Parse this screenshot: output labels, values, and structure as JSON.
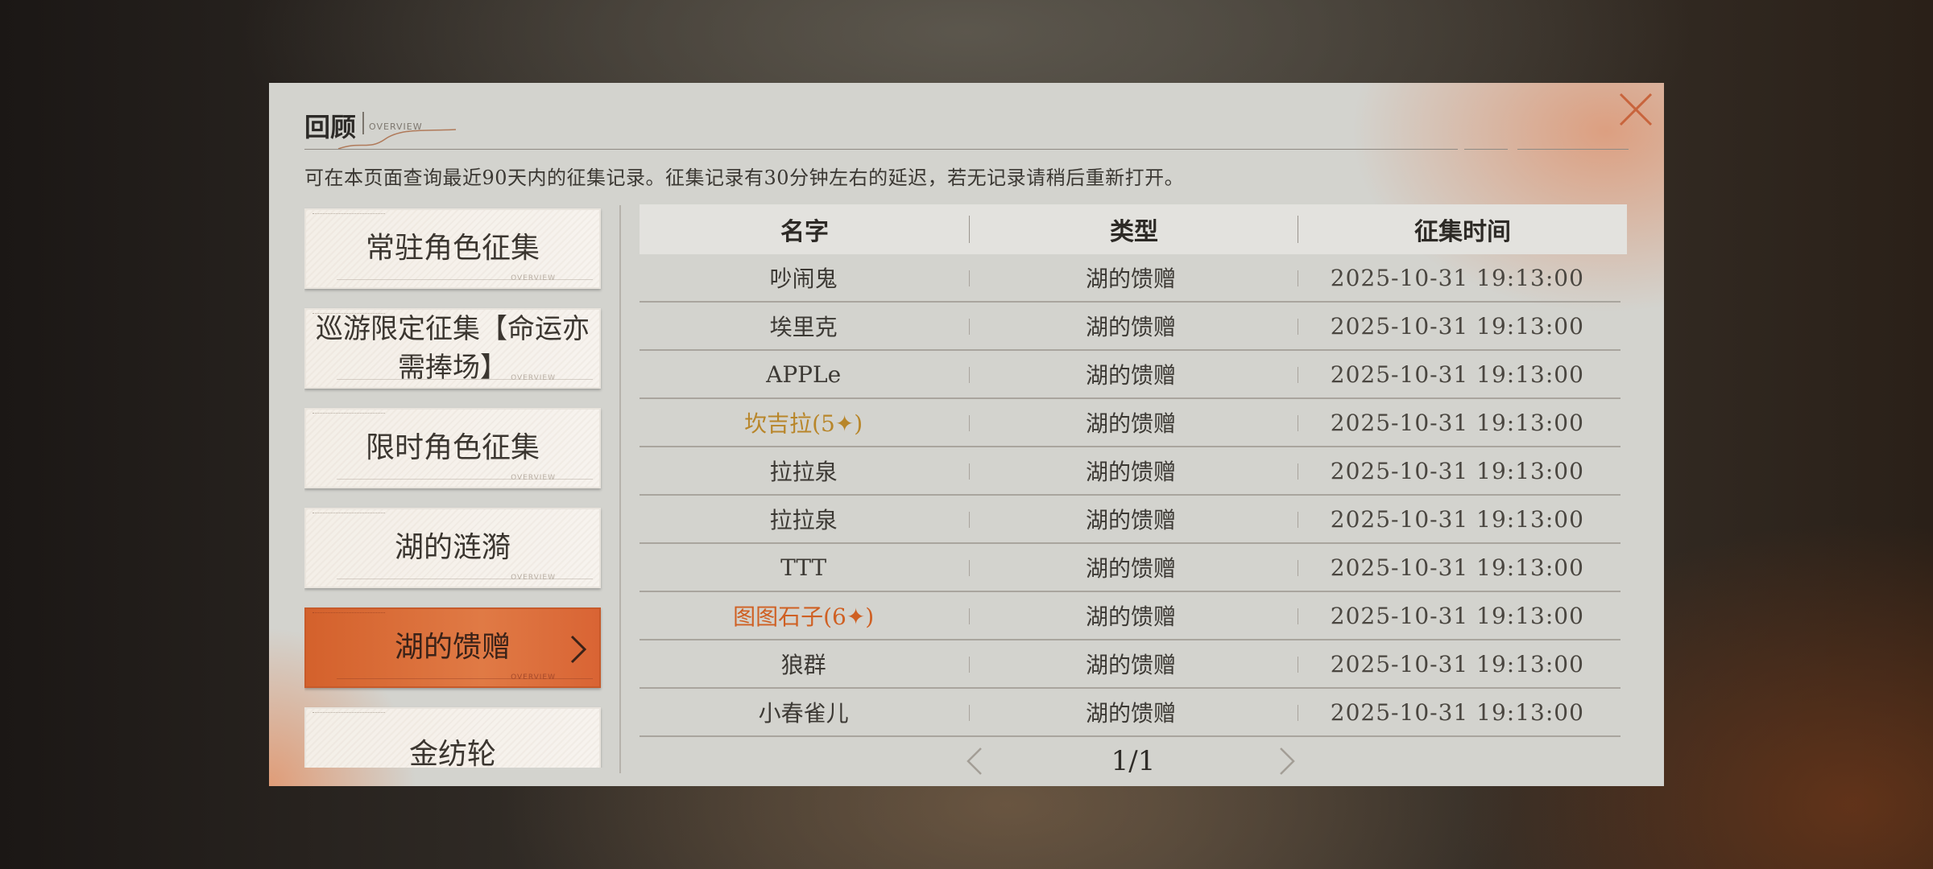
{
  "window": {
    "title": "回顾",
    "subtitle": "OVERVIEW",
    "notice": "可在本页面查询最近90天内的征集记录。征集记录有30分钟左右的延迟，若无记录请稍后重新打开。"
  },
  "sidebar": {
    "items": [
      {
        "label": "常驻角色征集",
        "active": false
      },
      {
        "label": "巡游限定征集【命运亦需捧场】",
        "active": false
      },
      {
        "label": "限时角色征集",
        "active": false
      },
      {
        "label": "湖的涟漪",
        "active": false
      },
      {
        "label": "湖的馈赠",
        "active": true
      },
      {
        "label": "金纺轮",
        "active": false
      }
    ],
    "card_caption": "OVERVIEW"
  },
  "table": {
    "headers": [
      "名字",
      "类型",
      "征集时间"
    ],
    "rows": [
      {
        "name": "吵闹鬼",
        "type": "湖的馈赠",
        "time": "2025-10-31 19:13:00",
        "rarity": "normal"
      },
      {
        "name": "埃里克",
        "type": "湖的馈赠",
        "time": "2025-10-31 19:13:00",
        "rarity": "normal"
      },
      {
        "name": "APPLe",
        "type": "湖的馈赠",
        "time": "2025-10-31 19:13:00",
        "rarity": "normal"
      },
      {
        "name": "坎吉拉(5✦)",
        "type": "湖的馈赠",
        "time": "2025-10-31 19:13:00",
        "rarity": "five-star"
      },
      {
        "name": "拉拉泉",
        "type": "湖的馈赠",
        "time": "2025-10-31 19:13:00",
        "rarity": "normal"
      },
      {
        "name": "拉拉泉",
        "type": "湖的馈赠",
        "time": "2025-10-31 19:13:00",
        "rarity": "normal"
      },
      {
        "name": "TTT",
        "type": "湖的馈赠",
        "time": "2025-10-31 19:13:00",
        "rarity": "normal"
      },
      {
        "name": "图图石子(6✦)",
        "type": "湖的馈赠",
        "time": "2025-10-31 19:13:00",
        "rarity": "six-star"
      },
      {
        "name": "狼群",
        "type": "湖的馈赠",
        "time": "2025-10-31 19:13:00",
        "rarity": "normal"
      },
      {
        "name": "小春雀儿",
        "type": "湖的馈赠",
        "time": "2025-10-31 19:13:00",
        "rarity": "normal"
      }
    ]
  },
  "pagination": {
    "label": "1/1",
    "prev_icon": "chevron-left-icon",
    "next_icon": "chevron-right-icon"
  },
  "colors": {
    "accent": "#d4612c",
    "five_star": "#b8862a",
    "six_star": "#cf6023",
    "panel_bg": "#d3d3ce"
  }
}
